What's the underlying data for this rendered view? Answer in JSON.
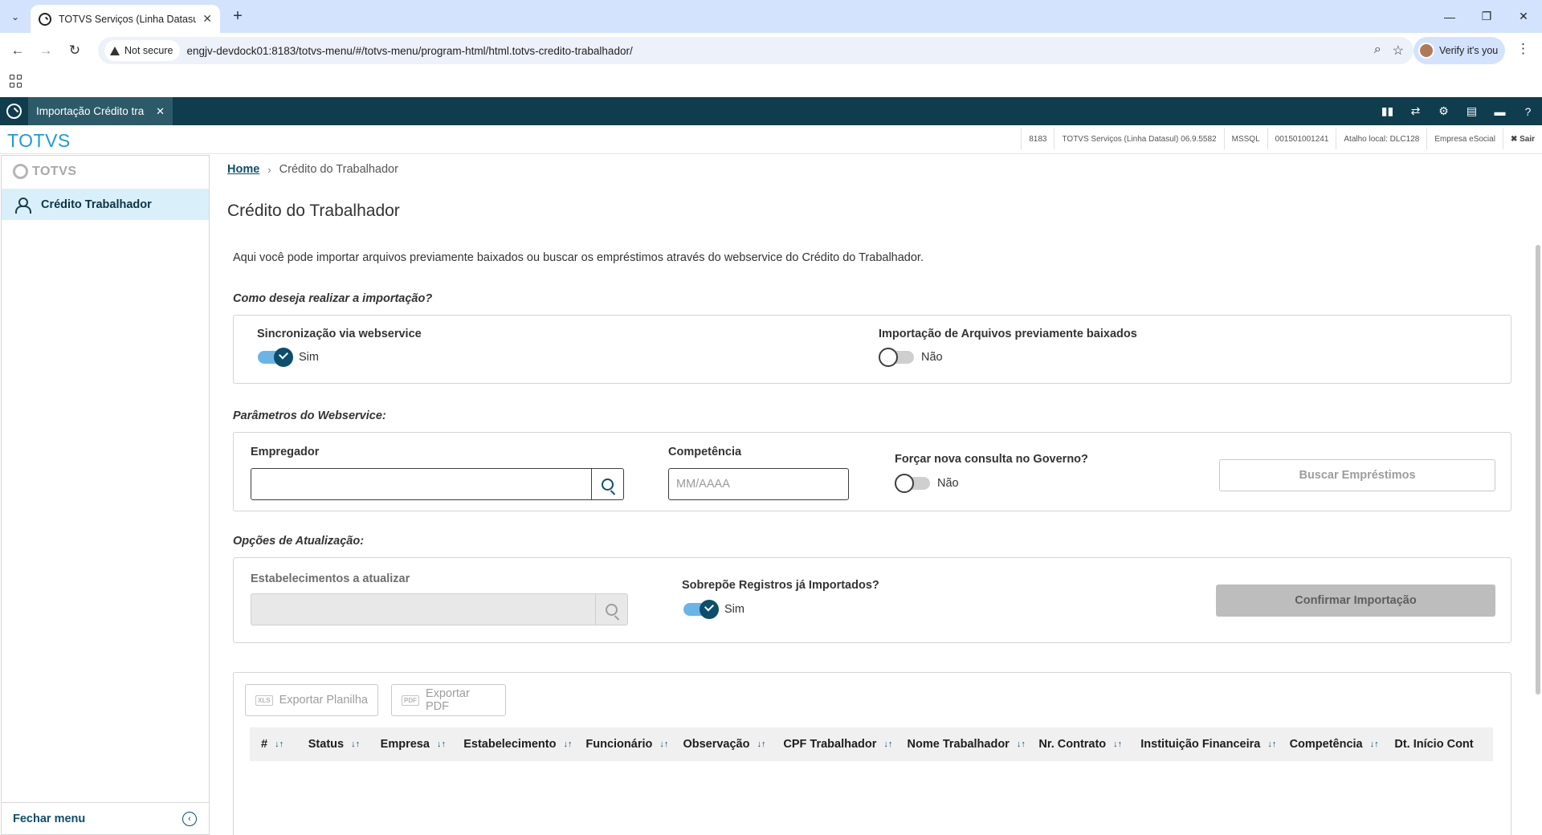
{
  "browser": {
    "tab_title": "TOTVS Serviços (Linha Datasul)",
    "security_label": "Not secure",
    "url": "engjv-devdock01:8183/totvs-menu/#/totvs-menu/program-html/html.totvs-credito-trabalhador/",
    "profile_chip": "Verify it's you"
  },
  "app": {
    "program_tab": "Importação Crédito tra",
    "brand": "TOTVS",
    "info_strip": [
      "8183",
      "TOTVS Serviços (Linha Datasul) 06.9.5582",
      "MSSQL",
      "001501001241",
      "Atalho local: DLC128",
      "Empresa eSocial"
    ],
    "exit_label": "✖ Sair"
  },
  "sidebar": {
    "logo_text": "TOTVS",
    "items": [
      {
        "label": "Crédito Trabalhador",
        "icon": "user-icon"
      }
    ],
    "footer_label": "Fechar menu"
  },
  "breadcrumb": {
    "home": "Home",
    "current": "Crédito do Trabalhador"
  },
  "page": {
    "title": "Crédito do Trabalhador",
    "intro": "Aqui você pode importar arquivos previamente baixados ou buscar os empréstimos através do webservice do Crédito do Trabalhador."
  },
  "import_mode": {
    "section_label": "Como deseja realizar a importação?",
    "webservice": {
      "label": "Sincronização via webservice",
      "state": "Sim"
    },
    "files": {
      "label": "Importação de Arquivos previamente baixados",
      "state": "Não"
    }
  },
  "ws_params": {
    "section_label": "Parâmetros do Webservice:",
    "employer_label": "Empregador",
    "employer_value": "",
    "competencia_label": "Competência",
    "competencia_placeholder": "MM/AAAA",
    "force_label": "Forçar nova consulta no Governo?",
    "force_state": "Não",
    "search_button": "Buscar Empréstimos"
  },
  "update_opts": {
    "section_label": "Opções de Atualização:",
    "estab_label": "Estabelecimentos a atualizar",
    "overwrite_label": "Sobrepõe Registros já Importados?",
    "overwrite_state": "Sim",
    "confirm_button": "Confirmar Importação"
  },
  "results": {
    "export_xls": "Exportar Planilha",
    "export_pdf": "Exportar PDF",
    "xls_badge": "XLS",
    "pdf_badge": "PDF",
    "columns": [
      "#",
      "Status",
      "Empresa",
      "Estabelecimento",
      "Funcionário",
      "Observação",
      "CPF Trabalhador",
      "Nome Trabalhador",
      "Nr. Contrato",
      "Instituição Financeira",
      "Competência",
      "Dt. Início Cont"
    ]
  },
  "colors": {
    "header_bg": "#0f3d4d",
    "accent": "#0c4e6b",
    "brand": "#1e9ad6",
    "switch_on": "#6bb4e6"
  }
}
